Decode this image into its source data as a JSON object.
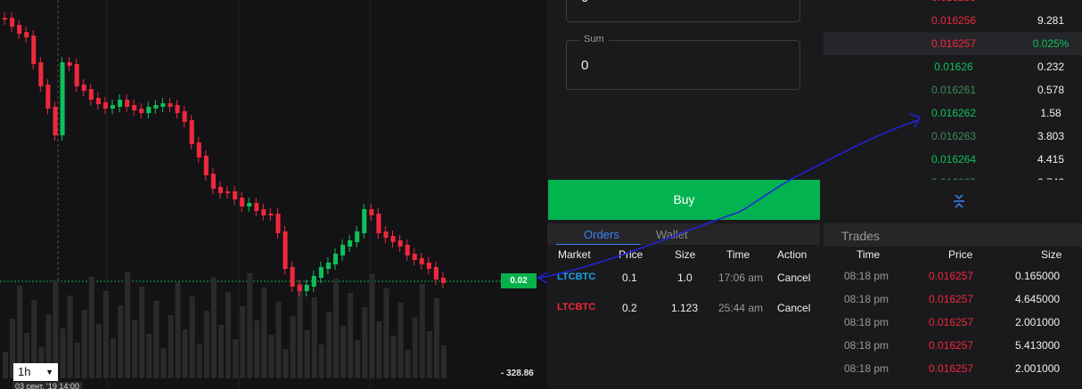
{
  "chart": {
    "current_price": "0.02",
    "volume_value": "328.86",
    "interval": "1h",
    "date_label": "03 сент. '19   14:00"
  },
  "form": {
    "first_field_value": "0",
    "sum_label": "Sum",
    "sum_value": "0",
    "buy_label": "Buy"
  },
  "orders": {
    "tabs": [
      "Orders",
      "Wallet"
    ],
    "columns": [
      "Market",
      "Price",
      "Size",
      "Time",
      "Action"
    ],
    "rows": [
      {
        "market": "LTCBTC",
        "price": "0.1",
        "size": "1.0",
        "time": "17:06 am",
        "action": "Cancel"
      },
      {
        "market": "LTCBTC",
        "price": "0.2",
        "size": "1.123",
        "time": "25:44 am",
        "action": "Cancel"
      }
    ]
  },
  "order_book": {
    "rows": [
      {
        "price": "0.016256",
        "size": "9.281"
      },
      {
        "price": "0.016257",
        "size": "0.025%"
      },
      {
        "price": "0.01626",
        "size": "0.232"
      },
      {
        "price": "0.016261",
        "size": "0.578"
      },
      {
        "price": "0.016262",
        "size": "1.58"
      },
      {
        "price": "0.016263",
        "size": "3.803"
      },
      {
        "price": "0.016264",
        "size": "4.415"
      }
    ],
    "colors": {
      "ask": "#f0283c",
      "bid": "#0fc05a",
      "muted_bid": "#3d8b56"
    }
  },
  "trades": {
    "title": "Trades",
    "columns": [
      "Time",
      "Price",
      "Size"
    ],
    "rows": [
      {
        "time": "08:18 pm",
        "price": "0.016257",
        "size": "0.165000"
      },
      {
        "time": "08:18 pm",
        "price": "0.016257",
        "size": "4.645000"
      },
      {
        "time": "08:18 pm",
        "price": "0.016257",
        "size": "2.001000"
      },
      {
        "time": "08:18 pm",
        "price": "0.016257",
        "size": "5.413000"
      },
      {
        "time": "08:18 pm",
        "price": "0.016257",
        "size": "2.001000"
      }
    ]
  },
  "colors": {
    "buy": "#03b34f",
    "accent": "#3b82f6",
    "candle_up": "#0fc05a",
    "candle_down": "#f0283c"
  }
}
